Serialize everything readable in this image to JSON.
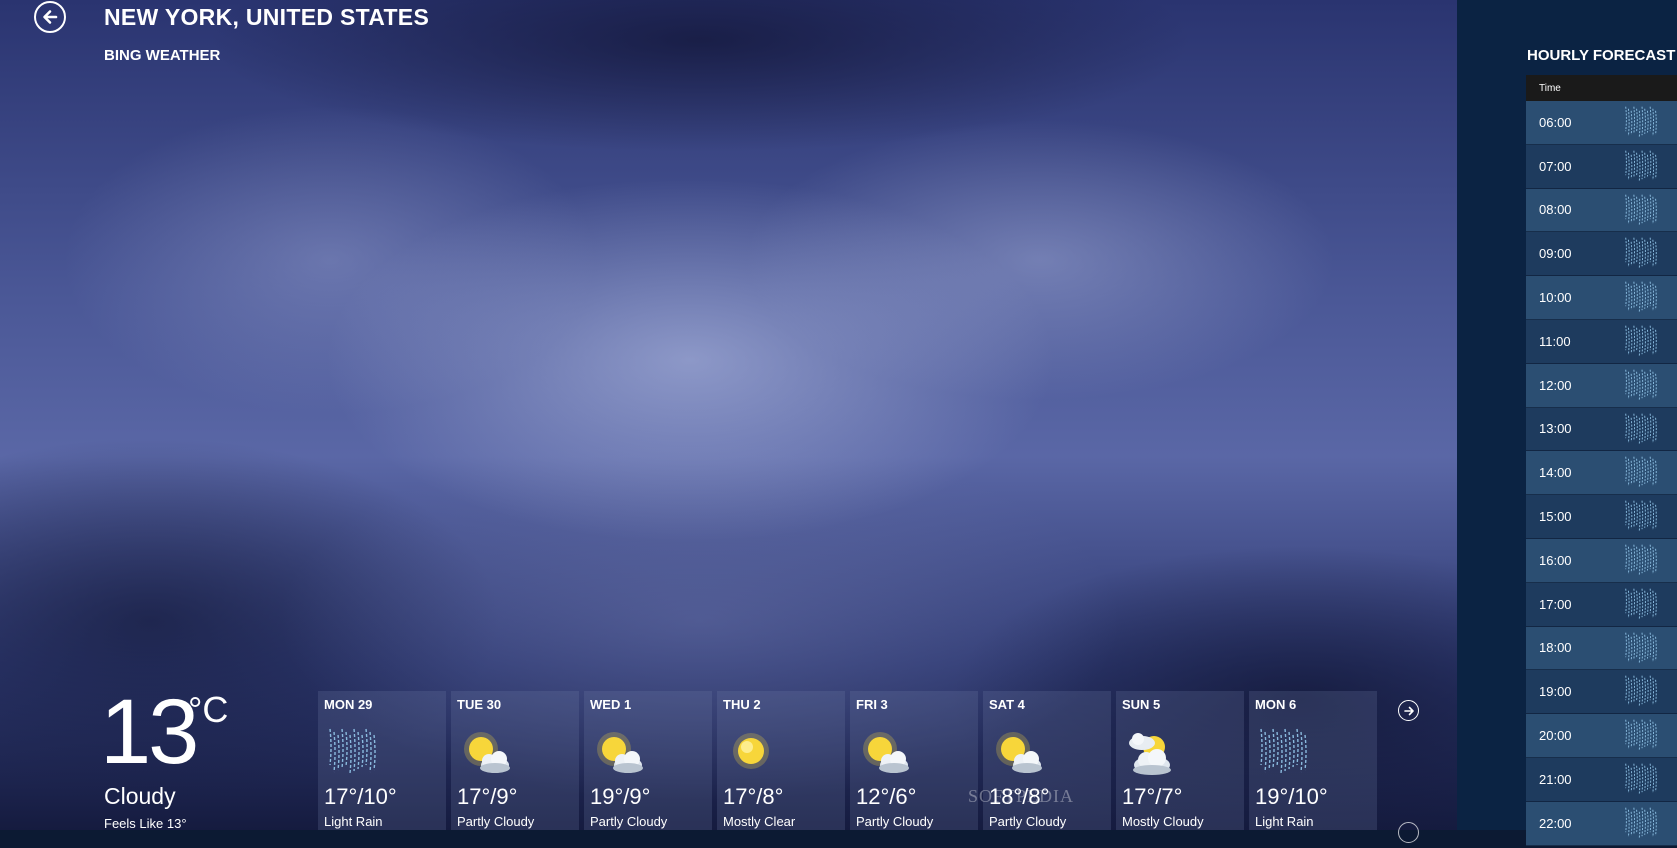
{
  "app": {
    "location_title": "NEW YORK, UNITED STATES",
    "app_name": "BING WEATHER",
    "back_icon": "back-arrow-icon"
  },
  "current": {
    "temperature": "13",
    "unit": "°C",
    "condition": "Cloudy",
    "feels_like": "Feels Like 13°"
  },
  "daily": [
    {
      "day": "MON 29",
      "temps": "17°/10°",
      "condition": "Light Rain",
      "icon": "rain-icon"
    },
    {
      "day": "TUE 30",
      "temps": "17°/9°",
      "condition": "Partly Cloudy",
      "icon": "partly-cloudy-icon"
    },
    {
      "day": "WED 1",
      "temps": "19°/9°",
      "condition": "Partly Cloudy",
      "icon": "partly-cloudy-icon"
    },
    {
      "day": "THU 2",
      "temps": "17°/8°",
      "condition": "Mostly Clear",
      "icon": "sun-icon"
    },
    {
      "day": "FRI 3",
      "temps": "12°/6°",
      "condition": "Partly Cloudy",
      "icon": "partly-cloudy-icon"
    },
    {
      "day": "SAT 4",
      "temps": "18°/8°",
      "condition": "Partly Cloudy",
      "icon": "partly-cloudy-icon"
    },
    {
      "day": "SUN 5",
      "temps": "17°/7°",
      "condition": "Mostly Cloudy",
      "icon": "mostly-cloudy-icon"
    },
    {
      "day": "MON 6",
      "temps": "19°/10°",
      "condition": "Light Rain",
      "icon": "rain-icon"
    }
  ],
  "hourly": {
    "title": "HOURLY FORECAST",
    "column_header": "Time",
    "rows": [
      {
        "time": "06:00",
        "icon": "rain-icon"
      },
      {
        "time": "07:00",
        "icon": "rain-icon"
      },
      {
        "time": "08:00",
        "icon": "rain-icon"
      },
      {
        "time": "09:00",
        "icon": "rain-icon"
      },
      {
        "time": "10:00",
        "icon": "rain-icon"
      },
      {
        "time": "11:00",
        "icon": "rain-icon"
      },
      {
        "time": "12:00",
        "icon": "rain-icon"
      },
      {
        "time": "13:00",
        "icon": "rain-icon"
      },
      {
        "time": "14:00",
        "icon": "rain-icon"
      },
      {
        "time": "15:00",
        "icon": "rain-icon"
      },
      {
        "time": "16:00",
        "icon": "rain-icon"
      },
      {
        "time": "17:00",
        "icon": "rain-icon"
      },
      {
        "time": "18:00",
        "icon": "rain-icon"
      },
      {
        "time": "19:00",
        "icon": "rain-icon"
      },
      {
        "time": "20:00",
        "icon": "rain-icon"
      },
      {
        "time": "21:00",
        "icon": "rain-icon"
      },
      {
        "time": "22:00",
        "icon": "rain-icon"
      }
    ]
  },
  "watermark": "SOFTPEDIA",
  "colors": {
    "sky_mid": "#5a67a6",
    "right_band": "#0b2343",
    "hourly_row_light": "#2b4e72",
    "hourly_row_dark": "#1e3b5e",
    "rain_streak": "#8fc2e6",
    "sun": "#f7d63a"
  }
}
